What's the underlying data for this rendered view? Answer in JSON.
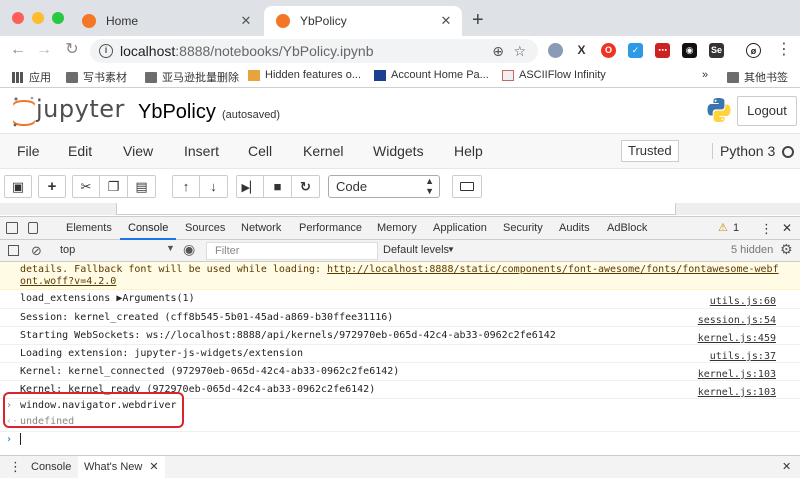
{
  "browser": {
    "tabs": [
      {
        "label": "Home",
        "active": false
      },
      {
        "label": "YbPolicy",
        "active": true
      }
    ],
    "url_host": "localhost",
    "url_path": ":8888/notebooks/YbPolicy.ipynb",
    "bookmarks": [
      {
        "label": "应用",
        "icon": "apps-grid-icon"
      },
      {
        "label": "写书素材",
        "icon": "folder-icon"
      },
      {
        "label": "亚马逊批量删除",
        "icon": "folder-icon"
      },
      {
        "label": "Hidden features o...",
        "icon": "bookmark-icon"
      },
      {
        "label": "Account Home Pa...",
        "icon": "bookmark-icon"
      },
      {
        "label": "ASCIIFlow Infinity",
        "icon": "bookmark-icon"
      }
    ],
    "bookmarks_more": "»",
    "other_bookmarks": "其他书签",
    "colors": {
      "tabstrip": "#dee1e6",
      "accent": "#1a73e8"
    }
  },
  "jupyter": {
    "logo_text": "jupyter",
    "notebook_name": "YbPolicy",
    "autosave_status": "(autosaved)",
    "logout_label": "Logout",
    "menus": [
      "File",
      "Edit",
      "View",
      "Insert",
      "Cell",
      "Kernel",
      "Widgets",
      "Help"
    ],
    "trusted_label": "Trusted",
    "kernel_name": "Python 3",
    "cell_type": "Code"
  },
  "devtools": {
    "tabs": [
      "Elements",
      "Console",
      "Sources",
      "Network",
      "Performance",
      "Memory",
      "Application",
      "Security",
      "Audits",
      "AdBlock"
    ],
    "active_tab": "Console",
    "warning_count": "1",
    "context": "top",
    "filter_placeholder": "Filter",
    "levels": "Default levels",
    "hidden_count": "5 hidden",
    "messages": [
      {
        "text": "details. Fallback font will be used while loading: ",
        "link": "http://localhost:8888/static/components/font-awesome/fonts/fontawesome-webf",
        "link2": "ont.woff?v=4.2.0",
        "type": "warning"
      },
      {
        "text": "load_extensions ▶Arguments(1)",
        "source": "utils.js:60"
      },
      {
        "text": "Session: kernel_created (cff8b545-5b01-45ad-a869-b30ffee31116)",
        "source": "session.js:54"
      },
      {
        "text": "Starting WebSockets: ws://localhost:8888/api/kernels/972970eb-065d-42c4-ab33-0962c2fe6142",
        "source": "kernel.js:459"
      },
      {
        "text": "Loading extension: jupyter-js-widgets/extension",
        "source": "utils.js:37"
      },
      {
        "text": "Kernel: kernel_connected (972970eb-065d-42c4-ab33-0962c2fe6142)",
        "source": "kernel.js:103"
      },
      {
        "text": "Kernel: kernel_ready (972970eb-065d-42c4-ab33-0962c2fe6142)",
        "source": "kernel.js:103"
      }
    ],
    "command_input": "window.navigator.webdriver",
    "command_result": "undefined",
    "drawer_tabs": [
      "Console",
      "What's New"
    ]
  }
}
